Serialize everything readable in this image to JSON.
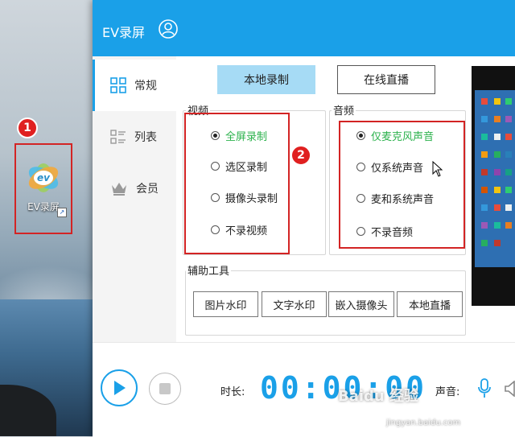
{
  "desktop": {
    "shortcut_label": "EV录屏",
    "badge_1": "1",
    "badge_2": "2"
  },
  "window": {
    "title": "EV录屏"
  },
  "sidebar": {
    "items": [
      {
        "label": "常规",
        "icon": "grid-icon",
        "active": true
      },
      {
        "label": "列表",
        "icon": "list-icon",
        "active": false
      },
      {
        "label": "会员",
        "icon": "crown-icon",
        "active": false
      }
    ]
  },
  "mode_buttons": {
    "local_record": "本地录制",
    "live_stream": "在线直播"
  },
  "video": {
    "title": "视频",
    "options": [
      {
        "label": "全屏录制",
        "checked": true
      },
      {
        "label": "选区录制",
        "checked": false
      },
      {
        "label": "摄像头录制",
        "checked": false
      },
      {
        "label": "不录视频",
        "checked": false
      }
    ]
  },
  "audio": {
    "title": "音频",
    "options": [
      {
        "label": "仅麦克风声音",
        "checked": true
      },
      {
        "label": "仅系统声音",
        "checked": false
      },
      {
        "label": "麦和系统声音",
        "checked": false
      },
      {
        "label": "不录音频",
        "checked": false
      }
    ]
  },
  "tools": {
    "title": "辅助工具",
    "buttons": [
      "图片水印",
      "文字水印",
      "嵌入摄像头",
      "本地直播"
    ]
  },
  "bottom": {
    "duration_label": "时长:",
    "timer": "00:00:00",
    "volume_label": "声音:"
  },
  "watermark": {
    "text": "Baidu 经验",
    "url": "jingyan.baidu.com"
  },
  "colors": {
    "accent": "#1aa0e8",
    "selected_text": "#2bb24c",
    "highlight_box": "#d32424",
    "local_button_bg": "#a6dbf5"
  }
}
